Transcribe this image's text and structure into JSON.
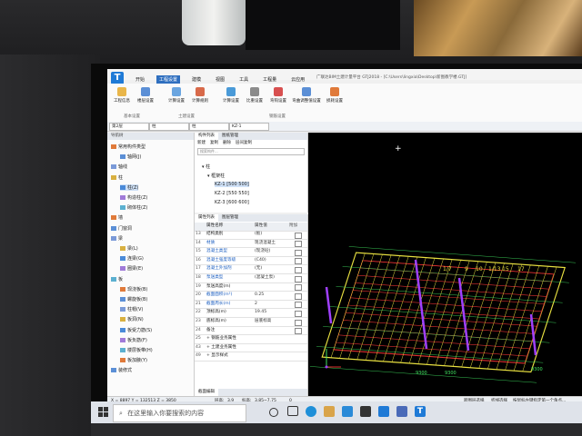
{
  "window": {
    "title": "广联达BIM土建计量平台 GTJ2018 - [C:\\Users\\lingxia\\Desktop\\新图教学楼.GTJ]"
  },
  "menu": [
    "开始",
    "工程设置",
    "建模",
    "视图",
    "工具",
    "工程量",
    "云应用"
  ],
  "ribbon": {
    "buttons": [
      "工程信息",
      "楼层设置",
      "计算设置",
      "计算规则",
      "计算设置",
      "比重设置",
      "弯钩设置",
      "弯曲调整值设置",
      "损耗设置"
    ],
    "groups": [
      "基本设置",
      "土建设置",
      "钢筋设置"
    ]
  },
  "selectors": {
    "floor": "第2层",
    "category": "柱",
    "type": "柱",
    "component": "KZ-1"
  },
  "nav": {
    "header": "导航树",
    "items": [
      "常用构件类型",
      "轴网(J)",
      "轴线",
      "柱",
      "柱(Z)",
      "构造柱(Z)",
      "砌体柱(Z)",
      "墙",
      "门窗洞",
      "梁",
      "梁(L)",
      "连梁(G)",
      "圈梁(E)",
      "板",
      "现浇板(B)",
      "螺旋板(B)",
      "柱帽(V)",
      "板洞(N)",
      "板受力筋(S)",
      "板负筋(F)",
      "楼层板带(H)",
      "板加腋(Y)",
      "装修式"
    ]
  },
  "component_list": {
    "tabs": [
      "构件列表",
      "图纸管理"
    ],
    "toolbar": [
      "新建",
      "复制",
      "删除",
      "层间复制"
    ],
    "search_placeholder": "搜索构件...",
    "tree": [
      "柱",
      "框架柱",
      "KZ-1 [500 500]",
      "KZ-2 [550 550]",
      "KZ-3 [600 600]"
    ]
  },
  "properties": {
    "tabs": [
      "属性列表",
      "图层管理"
    ],
    "headers": [
      "属性名称",
      "属性值",
      "附加"
    ],
    "rows": [
      {
        "no": "13",
        "name": "结构类别",
        "value": "(板)",
        "blue": false
      },
      {
        "no": "14",
        "name": "材质",
        "value": "现浇混凝土",
        "blue": true
      },
      {
        "no": "15",
        "name": "混凝土类型",
        "value": "(现浇砼)",
        "blue": true
      },
      {
        "no": "16",
        "name": "混凝土强度等级",
        "value": "(C40)",
        "blue": true
      },
      {
        "no": "17",
        "name": "混凝土外加剂",
        "value": "(无)",
        "blue": true
      },
      {
        "no": "18",
        "name": "泵送类型",
        "value": "(混凝土泵)",
        "blue": true
      },
      {
        "no": "19",
        "name": "泵送高度(m)",
        "value": "",
        "blue": false
      },
      {
        "no": "20",
        "name": "截面面积(m²)",
        "value": "0.25",
        "blue": true
      },
      {
        "no": "21",
        "name": "截面周长(m)",
        "value": "2",
        "blue": true
      },
      {
        "no": "22",
        "name": "顶标高(m)",
        "value": "19.45",
        "blue": false
      },
      {
        "no": "23",
        "name": "底标高(m)",
        "value": "层底标高",
        "blue": false
      },
      {
        "no": "24",
        "name": "备注",
        "value": "",
        "blue": false
      },
      {
        "no": "25",
        "name": "+ 钢筋业务属性",
        "value": "",
        "blue": false
      },
      {
        "no": "43",
        "name": "+ 土建业务属性",
        "value": "",
        "blue": false
      },
      {
        "no": "49",
        "name": "+ 显示样式",
        "value": "",
        "blue": false
      }
    ],
    "footer_tab": "截面编辑"
  },
  "canvas": {
    "axis_labels": [
      "1/7",
      "9",
      "10",
      "1/13",
      "15",
      "17"
    ],
    "bottom_dims": [
      "9300",
      "9300",
      "9300"
    ]
  },
  "status": {
    "coords": "X = 8897 Y = 132513 Z = 3850",
    "floor_height_label": "层高:",
    "floor_height": "3.9",
    "elevation_label": "标高:",
    "elevation": "3.85~7.75",
    "count": "0",
    "right_items": [
      "跨图层选择",
      "折线选择",
      "按鼠标左键指定第一个角点..."
    ]
  },
  "taskbar": {
    "search_placeholder": "在这里输入你要搜索的内容"
  },
  "colors": {
    "accent": "#2f6fbf",
    "canvas_bg": "#000000",
    "grid_red": "#e03030",
    "grid_yellow": "#e8e040",
    "grid_green": "#40e060",
    "column_purple": "#a040ff"
  }
}
